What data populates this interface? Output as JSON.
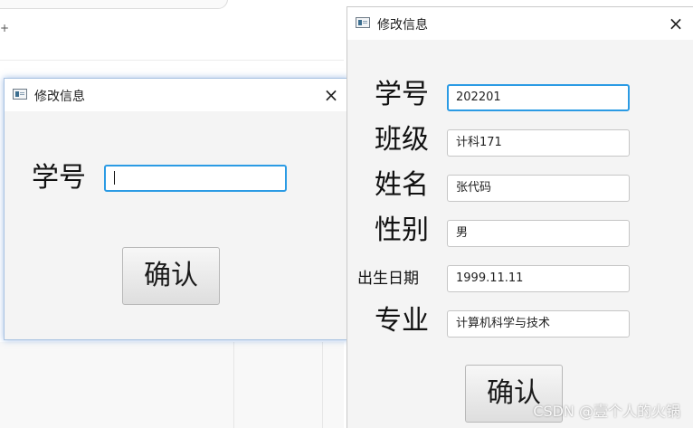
{
  "background": {
    "left_mark": "+"
  },
  "dialog_small": {
    "title": "修改信息",
    "close_icon": "×",
    "fields": [
      {
        "label": "学号",
        "value": ""
      }
    ],
    "confirm_label": "确认"
  },
  "dialog_large": {
    "title": "修改信息",
    "close_icon": "×",
    "fields": [
      {
        "label": "学号",
        "value": "202201"
      },
      {
        "label": "班级",
        "value": "计科171"
      },
      {
        "label": "姓名",
        "value": "张代码"
      },
      {
        "label": "性别",
        "value": "男"
      },
      {
        "label": "出生日期",
        "value": "1999.11.11"
      },
      {
        "label": "专业",
        "value": "计算机科学与技术"
      }
    ],
    "confirm_label": "确认"
  },
  "watermark": "CSDN @壹个人的火锅",
  "colors": {
    "focus_border": "#2b9be4",
    "window_bg": "#f4f4f4",
    "titlebar_bg": "#ffffff"
  }
}
